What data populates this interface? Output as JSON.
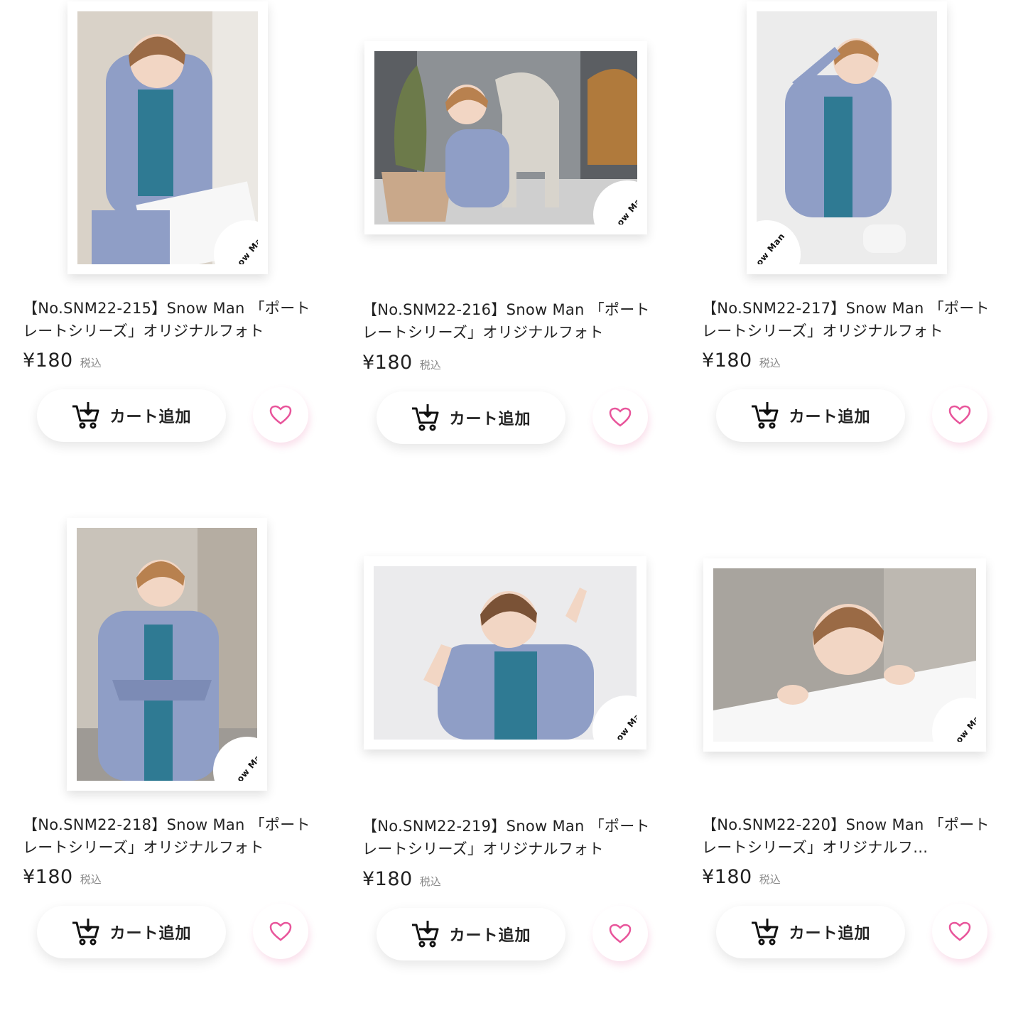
{
  "products": [
    {
      "title": "【No.SNM22-215】Snow Man 「ポートレートシリーズ」オリジナルフォト",
      "price": "¥180",
      "tax_label": "税込",
      "cart_label": "カート追加",
      "logo_text": "Snow Man"
    },
    {
      "title": "【No.SNM22-216】Snow Man 「ポートレートシリーズ」オリジナルフォト",
      "price": "¥180",
      "tax_label": "税込",
      "cart_label": "カート追加",
      "logo_text": "Snow Man"
    },
    {
      "title": "【No.SNM22-217】Snow Man 「ポートレートシリーズ」オリジナルフォト",
      "price": "¥180",
      "tax_label": "税込",
      "cart_label": "カート追加",
      "logo_text": "Snow Man"
    },
    {
      "title": "【No.SNM22-218】Snow Man 「ポートレートシリーズ」オリジナルフォト",
      "price": "¥180",
      "tax_label": "税込",
      "cart_label": "カート追加",
      "logo_text": "Snow Man"
    },
    {
      "title": "【No.SNM22-219】Snow Man 「ポートレートシリーズ」オリジナルフォト",
      "price": "¥180",
      "tax_label": "税込",
      "cart_label": "カート追加",
      "logo_text": "Snow Man"
    },
    {
      "title": "【No.SNM22-220】Snow Man 「ポートレートシリーズ」オリジナルフ…",
      "price": "¥180",
      "tax_label": "税込",
      "cart_label": "カート追加",
      "logo_text": "Snow Man"
    }
  ],
  "icons": {
    "cart": "cart-add-icon",
    "favorite": "heart-outline-icon"
  },
  "colors": {
    "heart": "#e8559b",
    "suit": "#8f9ec6",
    "shirt": "#2f7a93",
    "text": "#222222",
    "tax": "#888888"
  }
}
